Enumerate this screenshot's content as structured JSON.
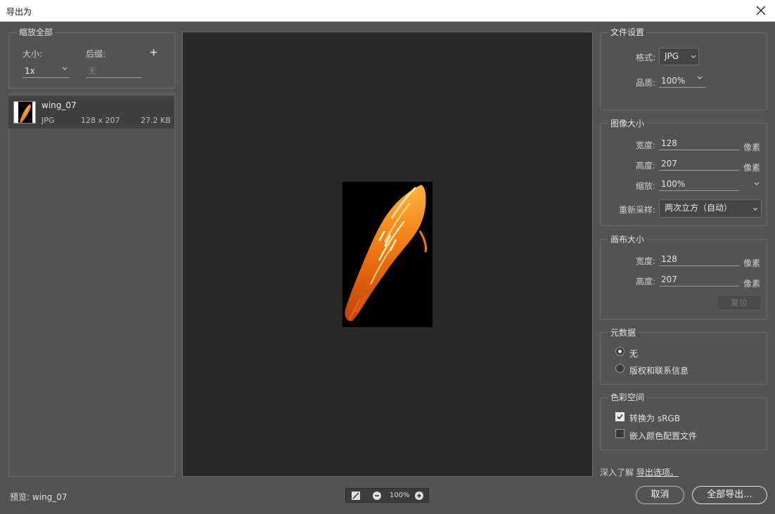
{
  "window": {
    "title": "导出为"
  },
  "left": {
    "panel_title": "缩放全部",
    "size_label": "大小:",
    "suffix_label": "后缀:",
    "add_icon": "plus-icon",
    "size_value": "1x",
    "suffix_placeholder": "无",
    "asset": {
      "name": "wing_07",
      "format": "JPG",
      "dimensions": "128 x 207",
      "filesize": "27.2 KB"
    }
  },
  "preview": {
    "zoom": "100%"
  },
  "file_settings": {
    "title": "文件设置",
    "format_label": "格式:",
    "format_value": "JPG",
    "quality_label": "品质:",
    "quality_value": "100%"
  },
  "image_size": {
    "title": "图像大小",
    "width_label": "宽度:",
    "width_value": "128",
    "height_label": "高度:",
    "height_value": "207",
    "scale_label": "缩放:",
    "scale_value": "100%",
    "resample_label": "重新采样:",
    "resample_value": "两次立方（自动）",
    "unit": "像素"
  },
  "canvas_size": {
    "title": "画布大小",
    "width_label": "宽度:",
    "width_value": "128",
    "height_label": "高度:",
    "height_value": "207",
    "unit": "像素",
    "reset_label": "复位"
  },
  "metadata": {
    "title": "元数据",
    "options": [
      "无",
      "版权和联系信息"
    ],
    "selected": "无"
  },
  "color_space": {
    "title": "色彩空间",
    "convert_srgb": "转换为 sRGB",
    "convert_checked": true,
    "embed_profile": "嵌入颜色配置文件",
    "embed_checked": false
  },
  "footer": {
    "learn_prefix": "深入了解",
    "learn_link": "导出选项。",
    "preview_label": "预览: wing_07",
    "cancel": "取消",
    "export_all": "全部导出..."
  }
}
